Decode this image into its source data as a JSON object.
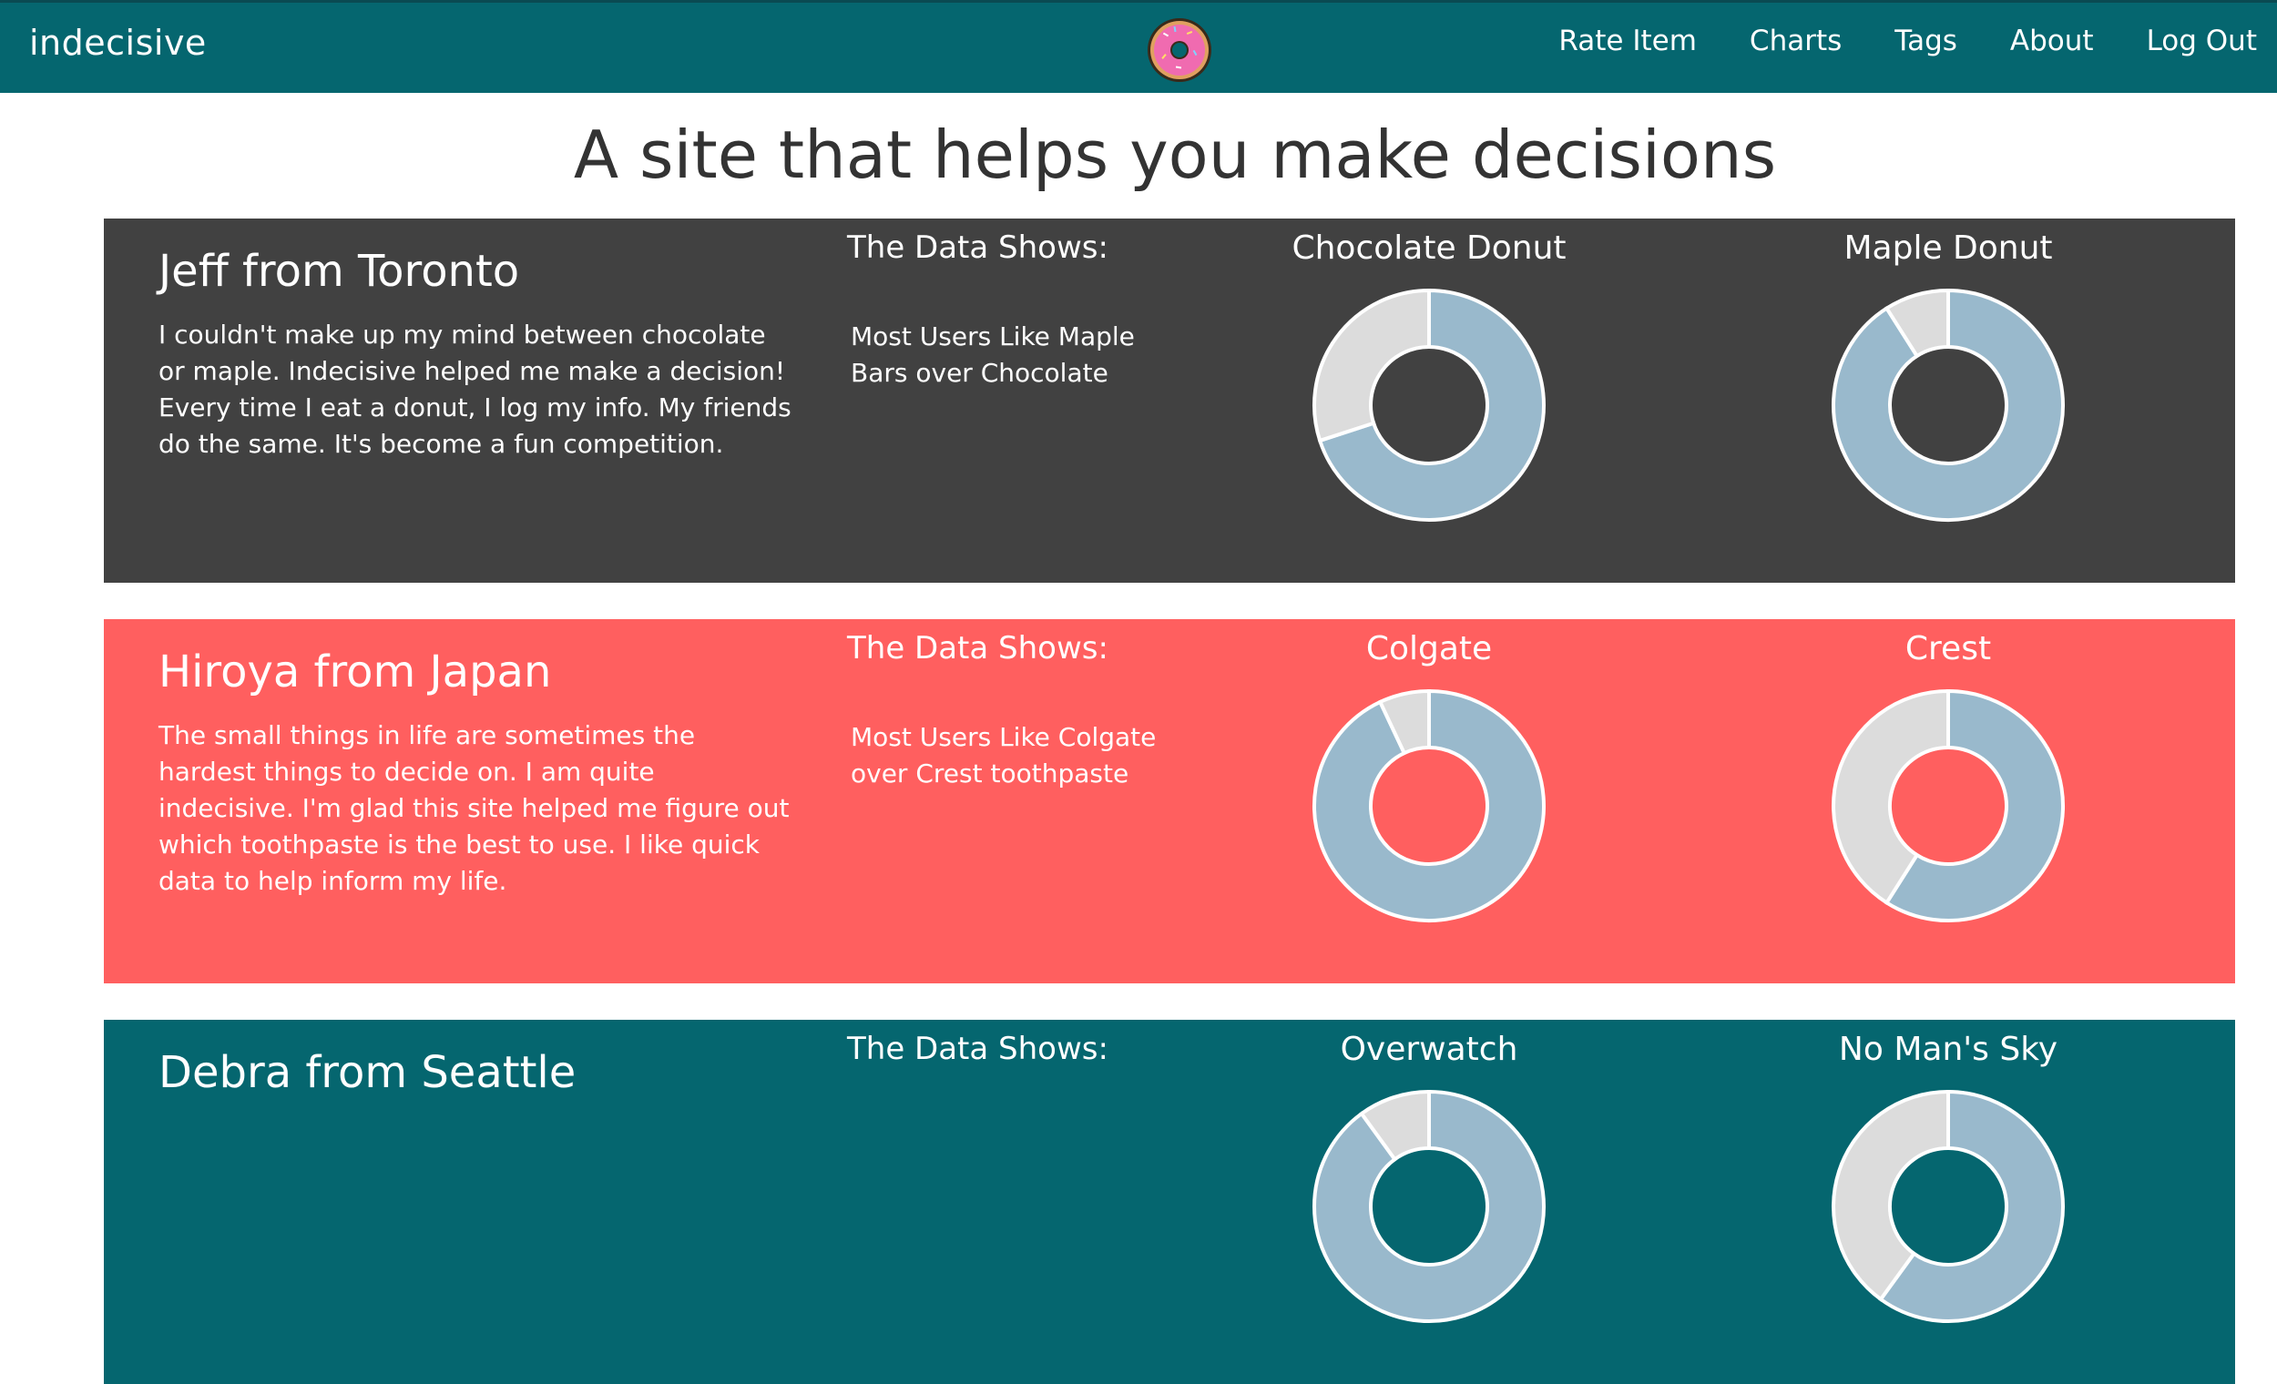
{
  "nav": {
    "brand": "indecisive",
    "links": [
      "Rate Item",
      "Charts",
      "Tags",
      "About",
      "Log Out"
    ],
    "logo_icon": "donut-icon",
    "background": "#05666f"
  },
  "headline": "A site that helps you make decisions",
  "colors": {
    "slice_primary": "#99b9cc",
    "slice_secondary": "#dcdcdc",
    "panel_dark": "#414141",
    "panel_red": "#ff5f5f",
    "panel_teal": "#05666f"
  },
  "testimonials": [
    {
      "name": "Jeff from Toronto",
      "text": "I couldn't make up my mind between chocolate or maple. Indecisive helped me make a decision! Every time I eat a donut, I log my info. My friends do the same. It's become a fun competition.",
      "data_heading": "The Data Shows:",
      "summary": "Most Users Like Maple Bars over Chocolate",
      "background": "#414141"
    },
    {
      "name": "Hiroya from Japan",
      "text": "The small things in life are sometimes the hardest things to decide on. I am quite indecisive. I'm glad this site helped me figure out which toothpaste is the best to use. I like quick data to help inform my life.",
      "data_heading": "The Data Shows:",
      "summary": "Most Users Like Colgate over Crest toothpaste",
      "background": "#ff5f5f"
    },
    {
      "name": "Debra from Seattle",
      "text": "",
      "data_heading": "The Data Shows:",
      "summary": "",
      "background": "#05666f"
    }
  ],
  "chart_data": [
    {
      "type": "pie",
      "title": "Chocolate Donut",
      "values": [
        70,
        30
      ],
      "colors": [
        "#99b9cc",
        "#dcdcdc"
      ],
      "donut": true
    },
    {
      "type": "pie",
      "title": "Maple Donut",
      "values": [
        91,
        9
      ],
      "colors": [
        "#99b9cc",
        "#dcdcdc"
      ],
      "donut": true
    },
    {
      "type": "pie",
      "title": "Colgate",
      "values": [
        93,
        7
      ],
      "colors": [
        "#99b9cc",
        "#dcdcdc"
      ],
      "donut": true
    },
    {
      "type": "pie",
      "title": "Crest",
      "values": [
        59,
        41
      ],
      "colors": [
        "#99b9cc",
        "#dcdcdc"
      ],
      "donut": true
    },
    {
      "type": "pie",
      "title": "Overwatch",
      "values": [
        90,
        10
      ],
      "colors": [
        "#99b9cc",
        "#dcdcdc"
      ],
      "donut": true
    },
    {
      "type": "pie",
      "title": "No Man's Sky",
      "values": [
        60,
        40
      ],
      "colors": [
        "#99b9cc",
        "#dcdcdc"
      ],
      "donut": true
    }
  ]
}
